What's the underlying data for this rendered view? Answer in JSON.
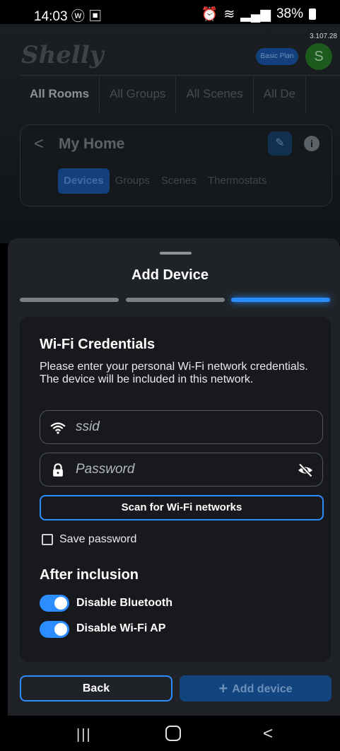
{
  "status_bar": {
    "time": "14:03",
    "battery": "38%",
    "icons_left": [
      "whatsapp-icon",
      "gallery-icon"
    ],
    "icons_right": [
      "alarm-icon",
      "wifi-icon",
      "signal-icon",
      "signal-icon"
    ]
  },
  "background_app": {
    "version": "3.107.28",
    "logo_text": "Shelly",
    "plan_badge": "Basic Plan",
    "avatar_letter": "S",
    "room_tabs": [
      "All Rooms",
      "All Groups",
      "All Scenes",
      "All De"
    ],
    "home_title": "My Home",
    "home_tabs": [
      "Devices",
      "Groups",
      "Scenes",
      "Thermostats"
    ]
  },
  "sheet": {
    "title": "Add Device",
    "steps_total": 3,
    "current_step": 3,
    "wifi": {
      "title": "Wi-Fi Credentials",
      "description": "Please enter your personal Wi-Fi network credentials. The device will be included in this network.",
      "ssid_placeholder": "ssid",
      "password_placeholder": "Password",
      "scan_button": "Scan for Wi-Fi networks",
      "save_password_label": "Save password",
      "save_password_checked": false
    },
    "after_inclusion": {
      "title": "After inclusion",
      "disable_bluetooth_label": "Disable Bluetooth",
      "disable_bluetooth_on": true,
      "disable_wifi_ap_label": "Disable Wi-Fi AP",
      "disable_wifi_ap_on": true
    },
    "back_button": "Back",
    "add_device_button": "Add device"
  },
  "colors": {
    "accent": "#2b8dff",
    "sheet_bg": "#1f2328",
    "card_bg": "#17191c"
  }
}
